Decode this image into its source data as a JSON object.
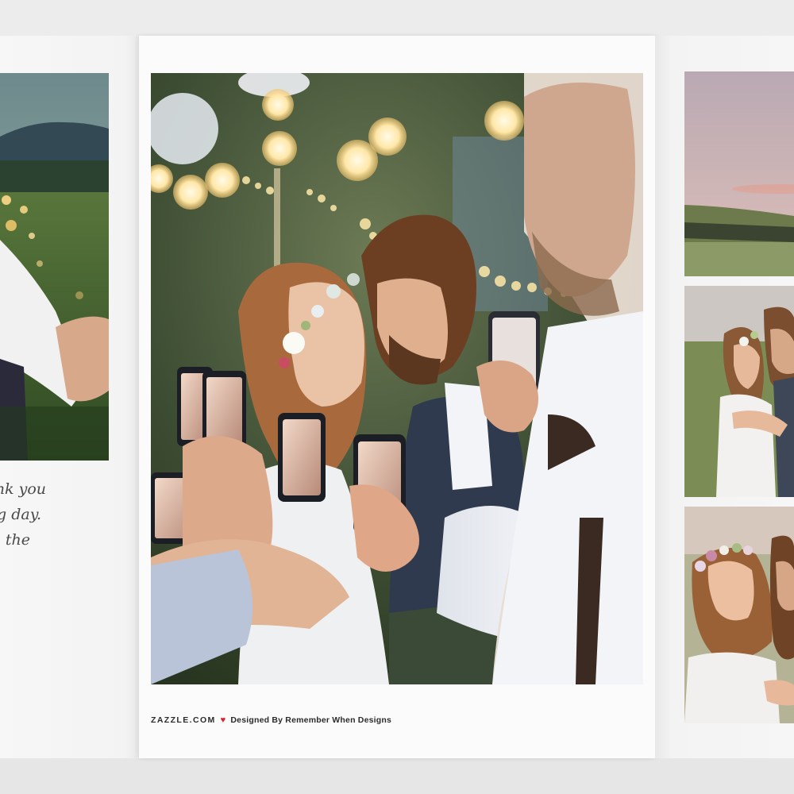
{
  "card": {
    "message_lines": [
      "nk you",
      "g day.",
      "the"
    ]
  },
  "footer": {
    "brand": "ZAZZLE.COM",
    "heart_icon": "heart-icon",
    "designer_text": "Designed By Remember When Designs"
  },
  "colors": {
    "heart": "#d3242f",
    "card_paper": "#fbfbfb"
  }
}
